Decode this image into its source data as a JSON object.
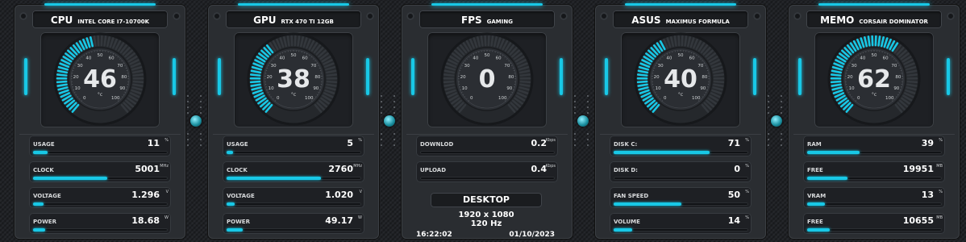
{
  "colors": {
    "accent": "#18c8e6",
    "panel": "#2a2d31",
    "background": "#202226"
  },
  "panels": [
    {
      "key": "cpu",
      "title": "CPU",
      "subtitle": "INTEL CORE I7-10700K",
      "gauge": {
        "value": "46",
        "level": 0.46,
        "unit": "°c",
        "ticks": [
          "0",
          "10",
          "20",
          "30",
          "40",
          "50",
          "60",
          "70",
          "80",
          "90",
          "100"
        ]
      },
      "rows": [
        {
          "label": "USAGE",
          "value": "11",
          "unit": "%",
          "level": 0.11
        },
        {
          "label": "CLOCK",
          "value": "5001",
          "unit": "MHz",
          "level": 0.55
        },
        {
          "label": "VOLTAGE",
          "value": "1.296",
          "unit": "V",
          "level": 0.08
        },
        {
          "label": "POWER",
          "value": "18.68",
          "unit": "W",
          "level": 0.09
        }
      ]
    },
    {
      "key": "gpu",
      "title": "GPU",
      "subtitle": "RTX 470 TI 12GB",
      "gauge": {
        "value": "38",
        "level": 0.38,
        "unit": "°c",
        "ticks": [
          "0",
          "10",
          "20",
          "30",
          "40",
          "50",
          "60",
          "70",
          "80",
          "90",
          "100"
        ]
      },
      "rows": [
        {
          "label": "USAGE",
          "value": "5",
          "unit": "%",
          "level": 0.05
        },
        {
          "label": "CLOCK",
          "value": "2760",
          "unit": "MHz",
          "level": 0.7
        },
        {
          "label": "VOLTAGE",
          "value": "1.020",
          "unit": "V",
          "level": 0.06
        },
        {
          "label": "POWER",
          "value": "49.17",
          "unit": "W",
          "level": 0.12
        }
      ]
    },
    {
      "key": "fps",
      "title": "FPS",
      "subtitle": "GAMING",
      "gauge": {
        "value": "0",
        "level": 0,
        "unit": "",
        "ticks": [
          "0",
          "10",
          "20",
          "30",
          "40",
          "50",
          "60",
          "70",
          "80",
          "90",
          "100"
        ]
      },
      "rows": [
        {
          "label": "DOWNLOD",
          "value": "0.2",
          "unit": "Kbps",
          "level": 0
        },
        {
          "label": "UPLOAD",
          "value": "0.4",
          "unit": "Kbps",
          "level": 0
        }
      ],
      "desktop": {
        "title": "DESKTOP",
        "resolution": "1920 x 1080",
        "refresh": "120 Hz",
        "time": "16:22:02",
        "date": "01/10/2023"
      }
    },
    {
      "key": "asus",
      "title": "ASUS",
      "subtitle": "MAXIMUS FORMULA",
      "gauge": {
        "value": "40",
        "level": 0.4,
        "unit": "°c",
        "ticks": [
          "0",
          "10",
          "20",
          "30",
          "40",
          "50",
          "60",
          "70",
          "80",
          "90",
          "100"
        ]
      },
      "rows": [
        {
          "label": "DISK C:",
          "value": "71",
          "unit": "%",
          "level": 0.71
        },
        {
          "label": "DISK D:",
          "value": "0",
          "unit": "%",
          "level": 0
        },
        {
          "label": "FAN SPEED",
          "value": "50",
          "unit": "%",
          "level": 0.5
        },
        {
          "label": "VOLUME",
          "value": "14",
          "unit": "%",
          "level": 0.14
        }
      ]
    },
    {
      "key": "memo",
      "title": "MEMO",
      "subtitle": "CORSAIR DOMINATOR",
      "gauge": {
        "value": "62",
        "level": 0.62,
        "unit": "°c",
        "ticks": [
          "0",
          "10",
          "20",
          "30",
          "40",
          "50",
          "60",
          "70",
          "80",
          "90",
          "100"
        ]
      },
      "rows": [
        {
          "label": "RAM",
          "value": "39",
          "unit": "%",
          "level": 0.39
        },
        {
          "label": "FREE",
          "value": "19951",
          "unit": "MB",
          "level": 0.3
        },
        {
          "label": "VRAM",
          "value": "13",
          "unit": "%",
          "level": 0.13
        },
        {
          "label": "FREE",
          "value": "10655",
          "unit": "MB",
          "level": 0.17
        }
      ]
    }
  ]
}
